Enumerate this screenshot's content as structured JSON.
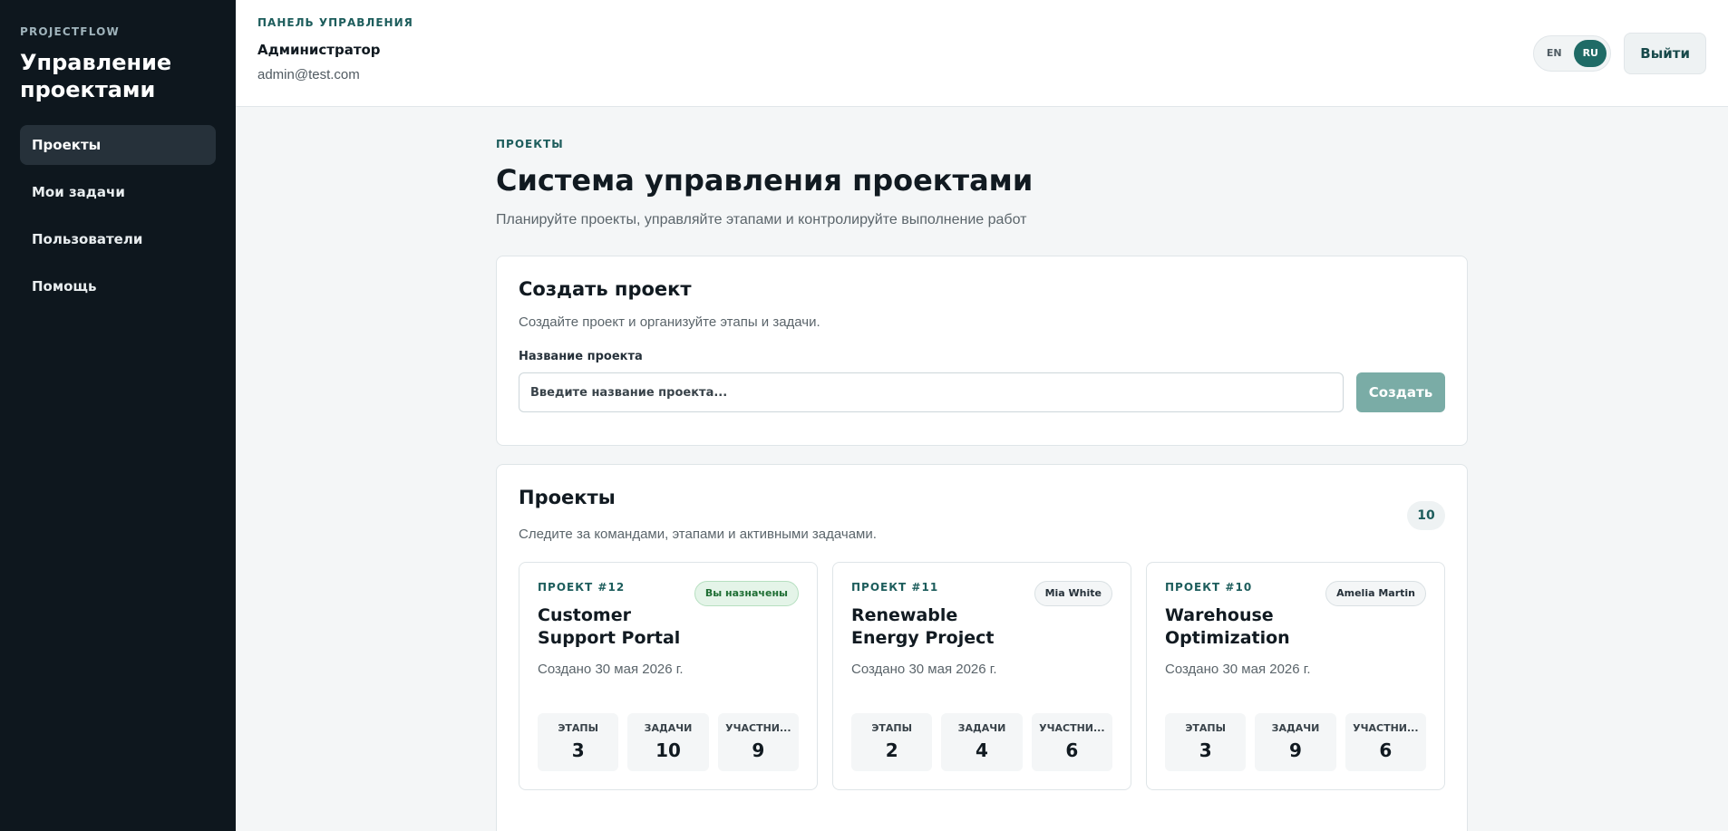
{
  "sidebar": {
    "brand": "PROJECTFLOW",
    "title": "Управление проектами",
    "items": [
      {
        "label": "Проекты",
        "active": true
      },
      {
        "label": "Мои задачи"
      },
      {
        "label": "Пользователи"
      },
      {
        "label": "Помощь"
      }
    ]
  },
  "header": {
    "eyebrow": "ПАНЕЛЬ УПРАВЛЕНИЯ",
    "user": "Администратор",
    "email": "admin@test.com",
    "lang_en": "EN",
    "lang_ru": "RU",
    "logout": "Выйти"
  },
  "page": {
    "eyebrow": "ПРОЕКТЫ",
    "title": "Система управления проектами",
    "subtitle": "Планируйте проекты, управляйте этапами и контролируйте выполнение работ"
  },
  "create": {
    "title": "Создать проект",
    "desc": "Создайте проект и организуйте этапы и задачи.",
    "label": "Название проекта",
    "placeholder": "Введите название проекта...",
    "button": "Создать"
  },
  "projects": {
    "title": "Проекты",
    "desc": "Следите за командами, этапами и активными задачами.",
    "count": "10",
    "stat_labels": [
      "ЭТАПЫ",
      "ЗАДАЧИ",
      "УЧАСТНИ..."
    ],
    "items": [
      {
        "num": "ПРОЕКТ #12",
        "name": "Customer Support Portal",
        "date": "Создано 30 мая 2026 г.",
        "tag": "Вы назначены",
        "stages": "3",
        "tasks": "10",
        "members": "9"
      },
      {
        "num": "ПРОЕКТ #11",
        "name": "Renewable Energy Project",
        "date": "Создано 30 мая 2026 г.",
        "tag": "Mia White",
        "stages": "2",
        "tasks": "4",
        "members": "6"
      },
      {
        "num": "ПРОЕКТ #10",
        "name": "Warehouse Optimization",
        "date": "Создано 30 мая 2026 г.",
        "tag": "Amelia Martin",
        "stages": "3",
        "tasks": "9",
        "members": "6"
      }
    ]
  }
}
